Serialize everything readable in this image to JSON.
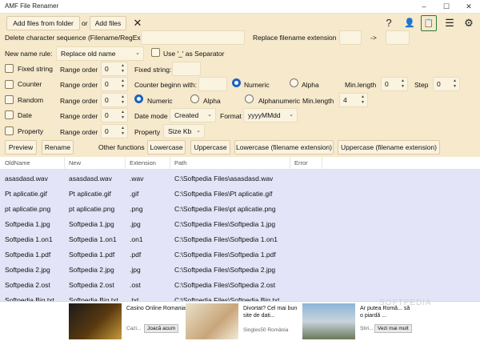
{
  "window": {
    "title": "AMF File Renamer",
    "minimize": "–",
    "maximize": "☐",
    "close": "✕"
  },
  "toolbar": {
    "add_folder": "Add files from folder",
    "or": "or",
    "add_files": "Add files",
    "clear": "✕",
    "help": "?",
    "user": "👤",
    "clipboard": "📋",
    "list": "☰",
    "settings": "⚙"
  },
  "delete_seq": {
    "label": "Delete character sequence (Filename/RegEx)",
    "replace_ext_label": "Replace filename extension",
    "arrow": "->"
  },
  "name_rule": {
    "label": "New name rule:",
    "value": "Replace old name",
    "use_sep": "Use '_' as Separator"
  },
  "rules": {
    "fixed_string": "Fixed string",
    "counter": "Counter",
    "random": "Random",
    "date": "Date",
    "property": "Property",
    "range_order": "Range order",
    "order_values": [
      "0",
      "0",
      "0",
      "0",
      "0"
    ],
    "fixed_string_label": "Fixed string:",
    "counter_begin": "Counter beginn with:",
    "numeric": "Numeric",
    "alpha": "Alpha",
    "min_length": "Min.length",
    "min_length_value": "0",
    "step": "Step",
    "step_value": "0",
    "alphanumeric": "Alphanumeric",
    "random_min_length": "Min.length",
    "random_min_length_value": "4",
    "date_mode": "Date mode",
    "date_mode_value": "Created",
    "format": "Format",
    "format_value": "yyyyMMdd",
    "property_label": "Property",
    "property_value": "Size Kb"
  },
  "actions": {
    "preview": "Preview",
    "rename": "Rename",
    "other": "Other functions",
    "lowercase": "Lowercase",
    "uppercase": "Uppercase",
    "lowercase_ext": "Lowercase (filename extension)",
    "uppercase_ext": "Uppercase (filename extension)"
  },
  "grid": {
    "headers": [
      "OldName",
      "New",
      "Extension",
      "Path",
      "Error"
    ],
    "rows": [
      [
        "asasdasd.wav",
        "asasdasd.wav",
        ".wav",
        "C:\\Softpedia Files\\asasdasd.wav",
        ""
      ],
      [
        "Pt aplicatie.gif",
        "Pt aplicatie.gif",
        ".gif",
        "C:\\Softpedia Files\\Pt aplicatie.gif",
        ""
      ],
      [
        "pt aplicatie.png",
        "pt aplicatie.png",
        ".png",
        "C:\\Softpedia Files\\pt aplicatie.png",
        ""
      ],
      [
        "Softpedia 1.jpg",
        "Softpedia 1.jpg",
        ".jpg",
        "C:\\Softpedia Files\\Softpedia 1.jpg",
        ""
      ],
      [
        "Softpedia 1.on1",
        "Softpedia 1.on1",
        ".on1",
        "C:\\Softpedia Files\\Softpedia 1.on1",
        ""
      ],
      [
        "Softpedia 1.pdf",
        "Softpedia 1.pdf",
        ".pdf",
        "C:\\Softpedia Files\\Softpedia 1.pdf",
        ""
      ],
      [
        "Softpedia 2.jpg",
        "Softpedia 2.jpg",
        ".jpg",
        "C:\\Softpedia Files\\Softpedia 2.jpg",
        ""
      ],
      [
        "Softpedia 2.ost",
        "Softpedia 2.ost",
        ".ost",
        "C:\\Softpedia Files\\Softpedia 2.ost",
        ""
      ],
      [
        "Softpedia Big.txt",
        "Softpedia Big.txt",
        ".txt",
        "C:\\Softpedia Files\\Softpedia Big.txt",
        ""
      ]
    ]
  },
  "ads": {
    "ad1_title": "Casino Online Romania | Cele ...",
    "ad1_src": "Cazi...",
    "ad1_btn": "Joacă acum",
    "ad2_title": "Divortat? Cel mai bun site de dati...",
    "ad2_src": "Singles50 România",
    "ad3_title": "Ar putea Româ... să o piardă ...",
    "ad3_src": "Știri...",
    "ad3_btn": "Vezi mai mult"
  },
  "watermark": "SOFTPEDIA",
  "colors": {
    "panel": "#f6e9cc",
    "grid": "#e3e4f8",
    "accent": "#1b62c2"
  }
}
